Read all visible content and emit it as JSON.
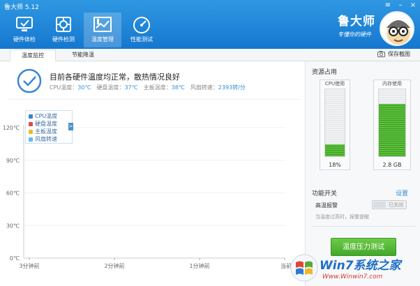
{
  "window": {
    "title": "鲁大师 5.12"
  },
  "nav": [
    {
      "label": "硬件体检",
      "icon": "monitor-check-icon"
    },
    {
      "label": "硬件检测",
      "icon": "circuit-board-icon"
    },
    {
      "label": "温度管理",
      "icon": "thermometer-chart-icon"
    },
    {
      "label": "性能测试",
      "icon": "speedometer-icon"
    }
  ],
  "brand": {
    "name": "鲁大师",
    "slogan": "专懂你的硬件"
  },
  "tabs": [
    {
      "label": "温度监控"
    },
    {
      "label": "节能降温"
    }
  ],
  "toolbar": {
    "screenshot_label": "保存截图",
    "screenshot_icon": "camera-icon"
  },
  "status": {
    "title": "目前各硬件温度均正常，散热情况良好",
    "cpu_label": "CPU温度：",
    "cpu_value": "30℃",
    "disk_label": "硬盘温度：",
    "disk_value": "37℃",
    "board_label": "主板温度：",
    "board_value": "38℃",
    "fan_label": "风扇转速：",
    "fan_value": "2393转/分"
  },
  "legend": {
    "items": [
      {
        "label": "CPU温度",
        "color": "#3d7fd6"
      },
      {
        "label": "硬盘温度",
        "color": "#e24b4b"
      },
      {
        "label": "主板温度",
        "color": "#f0b62d"
      },
      {
        "label": "风扇转速",
        "color": "#5cc0e8"
      }
    ],
    "toggle": ">"
  },
  "chart_data": {
    "type": "line",
    "y_ticks": [
      "120℃",
      "90℃",
      "60℃",
      "30℃",
      "0℃"
    ],
    "x_ticks": [
      "3分钟前",
      "2分钟前",
      "1分钟前",
      "当前"
    ],
    "ylim": [
      0,
      120
    ],
    "grid": true,
    "series": []
  },
  "resources": {
    "title": "资源占用",
    "cpu": {
      "label": "CPU使用",
      "value": "18%",
      "fraction": 0.18
    },
    "memory": {
      "label": "内存使用",
      "value": "2.8 GB",
      "fraction": 0.78
    }
  },
  "switches": {
    "title": "功能开关",
    "settings_label": "设置",
    "alarm": {
      "label": "高温报警",
      "state": "已关闭",
      "description": "当温度过高时，报警提醒"
    }
  },
  "stress_test": {
    "label": "温度压力测试"
  },
  "watermark": {
    "title": "Win7系统之家",
    "url": "Www.Winwin7.com"
  },
  "colors": {
    "header": "#1f86d8",
    "accent": "#2f8fd8",
    "green": "#4fb533"
  }
}
